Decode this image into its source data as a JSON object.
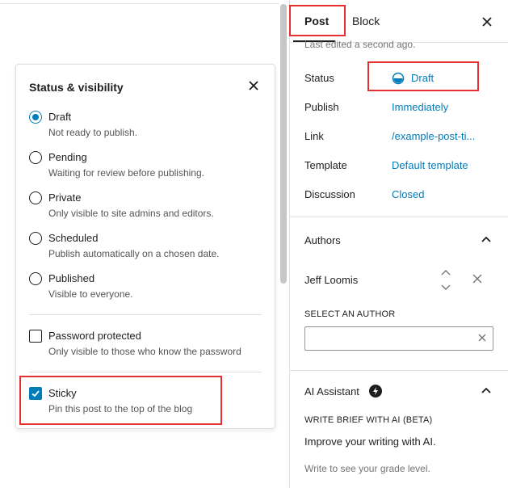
{
  "popover": {
    "title": "Status & visibility",
    "options": [
      {
        "label": "Draft",
        "desc": "Not ready to publish.",
        "checked": true
      },
      {
        "label": "Pending",
        "desc": "Waiting for review before publishing.",
        "checked": false
      },
      {
        "label": "Private",
        "desc": "Only visible to site admins and editors.",
        "checked": false
      },
      {
        "label": "Scheduled",
        "desc": "Publish automatically on a chosen date.",
        "checked": false
      },
      {
        "label": "Published",
        "desc": "Visible to everyone.",
        "checked": false
      }
    ],
    "password": {
      "label": "Password protected",
      "desc": "Only visible to those who know the password",
      "checked": false
    },
    "sticky": {
      "label": "Sticky",
      "desc": "Pin this post to the top of the blog",
      "checked": true
    }
  },
  "sidebar": {
    "tabs": [
      {
        "label": "Post",
        "active": true
      },
      {
        "label": "Block",
        "active": false
      }
    ],
    "last_edited": "Last edited a second ago.",
    "rows": [
      {
        "label": "Status",
        "value": "Draft"
      },
      {
        "label": "Publish",
        "value": "Immediately"
      },
      {
        "label": "Link",
        "value": "/example-post-ti..."
      },
      {
        "label": "Template",
        "value": "Default template"
      },
      {
        "label": "Discussion",
        "value": "Closed"
      }
    ],
    "authors": {
      "title": "Authors",
      "author_name": "Jeff Loomis",
      "select_label": "SELECT AN AUTHOR",
      "input_value": ""
    },
    "ai": {
      "title": "AI Assistant",
      "brief_label": "WRITE BRIEF WITH AI (BETA)",
      "improve_text": "Improve your writing with AI.",
      "grade_text": "Write to see your grade level."
    }
  },
  "colors": {
    "accent": "#007cba",
    "highlight": "#e63030",
    "text": "#1e1e1e",
    "muted": "#757575"
  },
  "icons": [
    "close-icon",
    "checkmark-icon",
    "half-circle-status-icon",
    "chevron-up-icon",
    "chevron-down-icon",
    "remove-x-icon",
    "lightning-icon"
  ]
}
